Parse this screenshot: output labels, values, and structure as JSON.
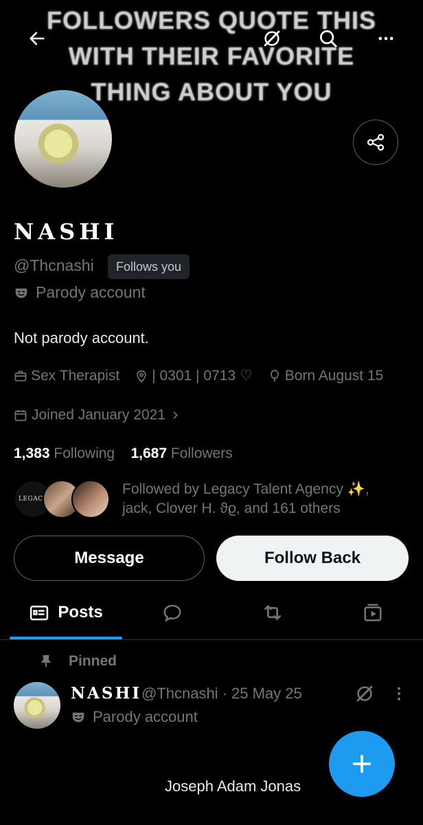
{
  "banner": {
    "text": "FOLLOWERS QUOTE THIS\nWITH THEIR FAVORITE\nTHING ABOUT YOU"
  },
  "profile": {
    "name": "NASHI",
    "handle": "@Thcnashi",
    "follows_you": "Follows you",
    "parody_label": "Parody account",
    "bio": "Not parody account.",
    "profession": "Sex Therapist",
    "location": "| 0301 | 0713 ♡",
    "birthday": "Born August 15",
    "joined": "Joined January 2021",
    "following_count": "1,383",
    "following_label": "Following",
    "followers_count": "1,687",
    "followers_label": "Followers",
    "followed_by_line1": "Followed by Legacy Talent Agency ✨,",
    "followed_by_line2": "jack, Clover H. ϑϱ, and 161 others",
    "legacy_logo_text": "LEGACY"
  },
  "actions": {
    "message": "Message",
    "follow_back": "Follow Back"
  },
  "tabs": {
    "posts": "Posts"
  },
  "pinned_post": {
    "pinned_label": "Pinned",
    "name": "NASHI",
    "handle": "@Thcnashi",
    "date": "· 25 May 25",
    "parody_label": "Parody account",
    "body": "Joseph Adam Jonas"
  },
  "colors": {
    "accent": "#1d9bf0",
    "background": "#000000",
    "muted": "#71767b"
  }
}
